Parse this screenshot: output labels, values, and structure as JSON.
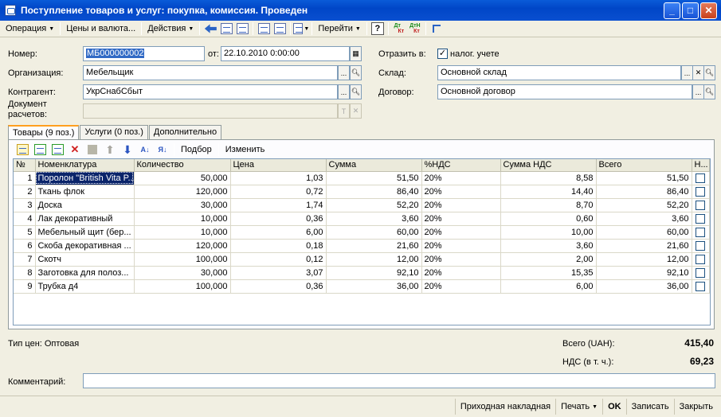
{
  "window": {
    "title": "Поступление товаров и услуг: покупка, комиссия. Проведен"
  },
  "toolbar": {
    "operation_label": "Операция",
    "prices_label": "Цены и валюта...",
    "actions_label": "Действия",
    "goto_label": "Перейти",
    "help_label": "?"
  },
  "form": {
    "number_label": "Номер:",
    "number_value": "МБ000000002",
    "date_label": "от:",
    "date_value": "22.10.2010  0:00:00",
    "reflect_label": "Отразить в:",
    "tax_label": "налог. учете",
    "org_label": "Организация:",
    "org_value": "Мебельщик",
    "warehouse_label": "Склад:",
    "warehouse_value": "Основной склад",
    "counterparty_label": "Контрагент:",
    "counterparty_value": "УкрСнабСбыт",
    "contract_label": "Договор:",
    "contract_value": "Основной договор",
    "settlement_label_1": "Документ",
    "settlement_label_2": "расчетов:",
    "settlement_value": ""
  },
  "tabs": [
    {
      "label": "Товары (9 поз.)"
    },
    {
      "label": "Услуги (0 поз.)"
    },
    {
      "label": "Дополнительно"
    }
  ],
  "tab_toolbar": {
    "selection_label": "Подбор",
    "change_label": "Изменить"
  },
  "table": {
    "headers": [
      "№",
      "Номенклатура",
      "Количество",
      "Цена",
      "Сумма",
      "%НДС",
      "Сумма НДС",
      "Всего",
      "Н..."
    ],
    "rows": [
      {
        "n": "1",
        "name": "Поролон \"British Vita P...",
        "qty": "50,000",
        "price": "1,03",
        "sum": "51,50",
        "vat": "20%",
        "vat_sum": "8,58",
        "total": "51,50"
      },
      {
        "n": "2",
        "name": "Ткань флок",
        "qty": "120,000",
        "price": "0,72",
        "sum": "86,40",
        "vat": "20%",
        "vat_sum": "14,40",
        "total": "86,40"
      },
      {
        "n": "3",
        "name": "Доска",
        "qty": "30,000",
        "price": "1,74",
        "sum": "52,20",
        "vat": "20%",
        "vat_sum": "8,70",
        "total": "52,20"
      },
      {
        "n": "4",
        "name": "Лак декоративный",
        "qty": "10,000",
        "price": "0,36",
        "sum": "3,60",
        "vat": "20%",
        "vat_sum": "0,60",
        "total": "3,60"
      },
      {
        "n": "5",
        "name": "Мебельный щит (бер...",
        "qty": "10,000",
        "price": "6,00",
        "sum": "60,00",
        "vat": "20%",
        "vat_sum": "10,00",
        "total": "60,00"
      },
      {
        "n": "6",
        "name": "Скоба декоративная ...",
        "qty": "120,000",
        "price": "0,18",
        "sum": "21,60",
        "vat": "20%",
        "vat_sum": "3,60",
        "total": "21,60"
      },
      {
        "n": "7",
        "name": "Скотч",
        "qty": "100,000",
        "price": "0,12",
        "sum": "12,00",
        "vat": "20%",
        "vat_sum": "2,00",
        "total": "12,00"
      },
      {
        "n": "8",
        "name": "Заготовка для полоз...",
        "qty": "30,000",
        "price": "3,07",
        "sum": "92,10",
        "vat": "20%",
        "vat_sum": "15,35",
        "total": "92,10"
      },
      {
        "n": "9",
        "name": "Трубка д4",
        "qty": "100,000",
        "price": "0,36",
        "sum": "36,00",
        "vat": "20%",
        "vat_sum": "6,00",
        "total": "36,00"
      }
    ]
  },
  "footer": {
    "price_type": "Тип цен: Оптовая",
    "total_label": "Всего (UAH):",
    "total_value": "415,40",
    "vat_label": "НДС (в т. ч.):",
    "vat_value": "69,23",
    "comment_label": "Комментарий:",
    "comment_value": ""
  },
  "bottom_bar": {
    "invoice_label": "Приходная накладная",
    "print_label": "Печать",
    "ok_label": "OK",
    "save_label": "Записать",
    "close_label": "Закрыть"
  }
}
